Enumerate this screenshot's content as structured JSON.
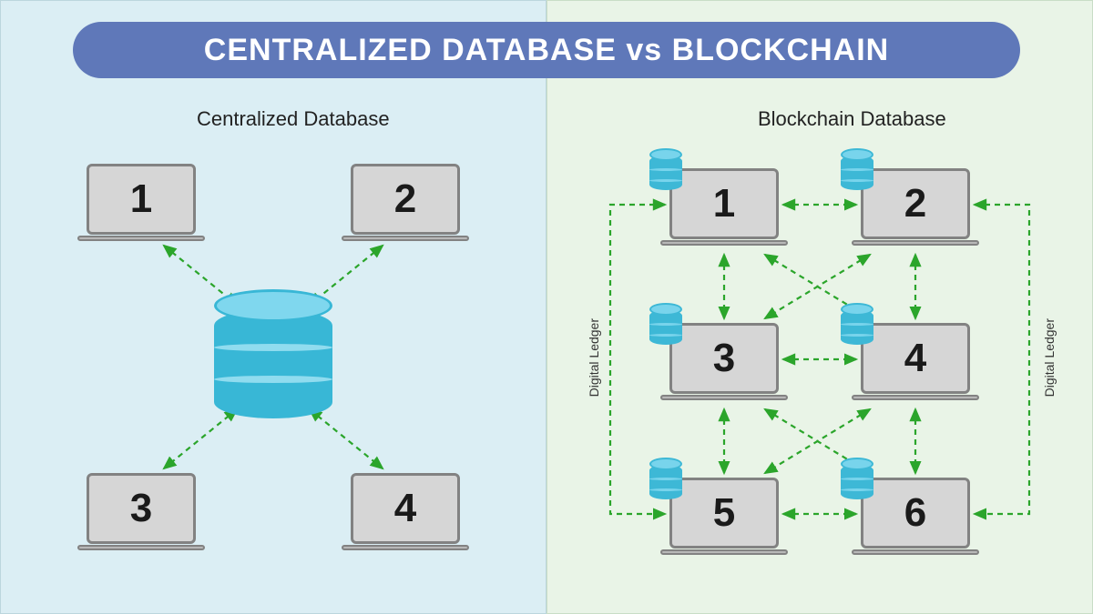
{
  "title": "CENTRALIZED DATABASE vs BLOCKCHAIN",
  "left": {
    "heading": "Centralized Database",
    "nodes": [
      "1",
      "2",
      "3",
      "4"
    ],
    "central_element": "database-cylinder"
  },
  "right": {
    "heading": "Blockchain Database",
    "nodes": [
      "1",
      "2",
      "3",
      "4",
      "5",
      "6"
    ],
    "ledger_label": "Digital Ledger",
    "node_attachment": "mini-database-cylinder"
  },
  "colors": {
    "title_bg": "#5f78b9",
    "left_bg": "#dbeef4",
    "right_bg": "#e9f4e7",
    "arrow": "#2ba52b",
    "db_primary": "#38b7d6",
    "db_light": "#7fd7ee"
  },
  "topology": {
    "centralized": "four client laptops each bidirectionally connected to one central database",
    "blockchain": "six peer laptops, each holding a digital ledger, bidirectionally mesh-connected to neighbors and diagonals"
  }
}
